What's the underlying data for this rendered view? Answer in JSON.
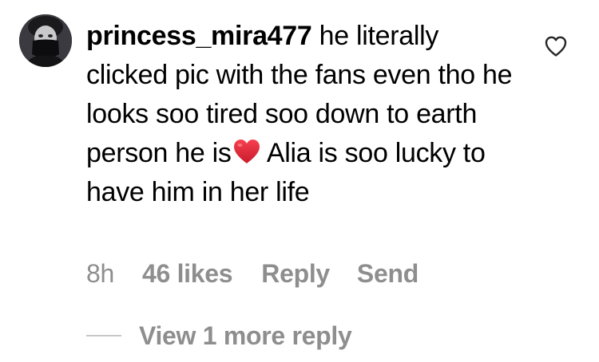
{
  "comment": {
    "username": "princess_mira477",
    "text_before_emoji": " he literally clicked pic with the fans even tho he looks soo tired soo down to earth person he is",
    "emoji": "red-heart-emoji",
    "text_after_emoji": " Alia is soo lucky to have him in her life",
    "like_icon": "heart-outline-icon"
  },
  "actions": {
    "timestamp": "8h",
    "likes": "46 likes",
    "reply": "Reply",
    "send": "Send"
  },
  "replies": {
    "view_more": "View 1 more reply"
  },
  "colors": {
    "text": "#000000",
    "secondary_text": "#8e8e8e",
    "divider": "#c7c7c7",
    "heart_emoji": "#e0243a"
  }
}
